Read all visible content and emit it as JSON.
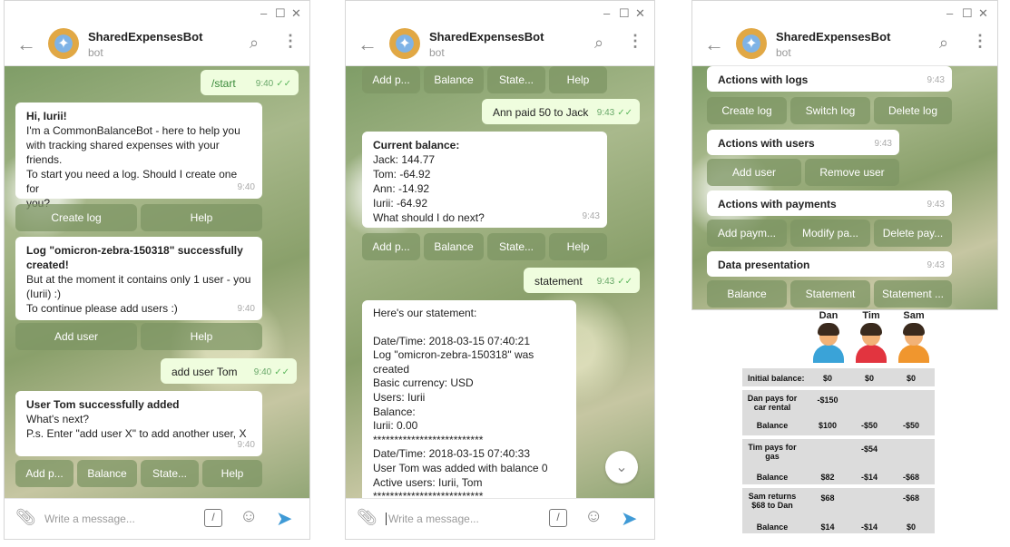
{
  "bot": {
    "name": "SharedExpensesBot",
    "status": "bot"
  },
  "window_controls": {
    "minimize": "–",
    "maximize": "☐",
    "close": "✕"
  },
  "composer": {
    "placeholder": "Write a message...",
    "cmd": "/"
  },
  "panel1": {
    "messages": [
      {
        "lines": [
          "/start"
        ],
        "time": "9:40",
        "outgoing": true
      },
      {
        "title": "Hi, Iurii!",
        "lines": [
          "I'm a CommonBalanceBot - here to help you",
          "with tracking shared expenses with your",
          "friends.",
          "To start you need a log. Should I create one for",
          "you?"
        ],
        "time": "9:40"
      },
      {
        "title": "Log \"omicron-zebra-150318\" successfully",
        "title2": "created!",
        "lines": [
          "But at the moment it contains only 1 user - you",
          "(Iurii) :)",
          "To continue please add users :)"
        ],
        "time": "9:40"
      },
      {
        "lines": [
          "add user Tom"
        ],
        "time": "9:40",
        "outgoing": true
      },
      {
        "title": "User Tom successfully added",
        "lines": [
          "What's next?",
          "P.s. Enter \"add user X\" to add another user, X"
        ],
        "time": "9:40"
      }
    ],
    "kb1": [
      "Create log",
      "Help"
    ],
    "kb2": [
      "Add user",
      "Help"
    ],
    "kb3": [
      "Add p...",
      "Balance",
      "State...",
      "Help"
    ]
  },
  "panel2": {
    "kb_top": [
      "Add p...",
      "Balance",
      "State...",
      "Help"
    ],
    "messages": [
      {
        "lines": [
          "Ann paid 50 to Jack"
        ],
        "time": "9:43",
        "outgoing": true
      },
      {
        "title": "Current balance:",
        "lines": [
          "Jack: 144.77",
          "Tom: -64.92",
          "Ann: -14.92",
          "Iurii: -64.92",
          "What should I do next?"
        ],
        "time": "9:43"
      },
      {
        "lines": [
          "statement"
        ],
        "time": "9:43",
        "outgoing": true
      },
      {
        "lines": [
          "Here's our statement:",
          "",
          "Date/Time: 2018-03-15 07:40:21",
          "Log \"omicron-zebra-150318\" was created",
          "Basic currency: USD",
          "Users: Iurii",
          "Balance:",
          "Iurii: 0.00",
          "**************************",
          "Date/Time: 2018-03-15 07:40:33",
          "User Tom was added with balance 0",
          "Active users: Iurii, Tom",
          "**************************"
        ]
      }
    ],
    "kb_mid": [
      "Add p...",
      "Balance",
      "State...",
      "Help"
    ],
    "scroll_icon": "chevron-down"
  },
  "panel3": {
    "groups": [
      {
        "title": "Actions with logs",
        "time": "9:43",
        "buttons": [
          "Create log",
          "Switch log",
          "Delete log"
        ]
      },
      {
        "title": "Actions with users",
        "time": "9:43",
        "buttons": [
          "Add user",
          "Remove user"
        ]
      },
      {
        "title": "Actions with payments",
        "time": "9:43",
        "buttons": [
          "Add paym...",
          "Modify pa...",
          "Delete pay..."
        ]
      },
      {
        "title": "Data presentation",
        "time": "9:43",
        "buttons": [
          "Balance",
          "Statement",
          "Statement ..."
        ]
      }
    ]
  },
  "figure": {
    "people": [
      {
        "name": "Dan",
        "color": "#3aa3d8"
      },
      {
        "name": "Tim",
        "color": "#e2343f"
      },
      {
        "name": "Sam",
        "color": "#f0962e"
      }
    ],
    "rows": [
      {
        "label": "Initial balance:",
        "values": [
          "$0",
          "$0",
          "$0"
        ]
      },
      {
        "label": "Dan pays for car rental",
        "values": [
          "-$150",
          "",
          ""
        ],
        "sub": {
          "label": "Balance",
          "values": [
            "$100",
            "-$50",
            "-$50"
          ]
        }
      },
      {
        "label": "Tim pays for gas",
        "values": [
          "",
          "-$54",
          ""
        ],
        "sub": {
          "label": "Balance",
          "values": [
            "$82",
            "-$14",
            "-$68"
          ]
        }
      },
      {
        "label": "Sam returns $68 to Dan",
        "values": [
          "$68",
          "",
          "-$68"
        ],
        "sub": {
          "label": "Balance",
          "values": [
            "$14",
            "-$14",
            "$0"
          ]
        }
      }
    ]
  }
}
